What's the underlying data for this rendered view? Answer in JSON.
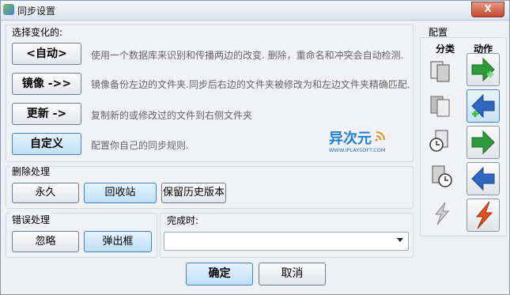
{
  "window": {
    "title": "同步设置",
    "close_label": "X"
  },
  "variant": {
    "group_label": "选择变化的:",
    "options": [
      {
        "label": "<自动>",
        "desc": "使用一个数据库来识别和传播两边的改变. 删除，重命名和冲突会自动检测."
      },
      {
        "label": "镜像 ->>",
        "desc": "镜像备份左边的文件夹.同步后右边的文件夹被修改为和左边文件夹精确匹配."
      },
      {
        "label": "更新 ->",
        "desc": "复制新的或修改过的文件到右侧文件夹"
      },
      {
        "label": "自定义",
        "desc": "配置你自己的同步规则."
      }
    ]
  },
  "logo": {
    "text": "异次元",
    "subtext": "WWW.IPLAYSOFT.COM"
  },
  "deletion": {
    "group_label": "删除处理",
    "options": [
      "永久",
      "回收站",
      "保留历史版本"
    ]
  },
  "error": {
    "group_label": "错误处理",
    "options": [
      "忽略",
      "弹出框"
    ]
  },
  "finish": {
    "label": "完成时:",
    "value": ""
  },
  "config": {
    "group_label": "配置",
    "category_header": "分类",
    "action_header": "动作"
  },
  "buttons": {
    "ok": "确定",
    "cancel": "取消"
  },
  "colors": {
    "accent": "#3f83c4",
    "action_green": "#2e9a3a",
    "action_blue": "#2f67c2",
    "action_red": "#e0521e"
  }
}
